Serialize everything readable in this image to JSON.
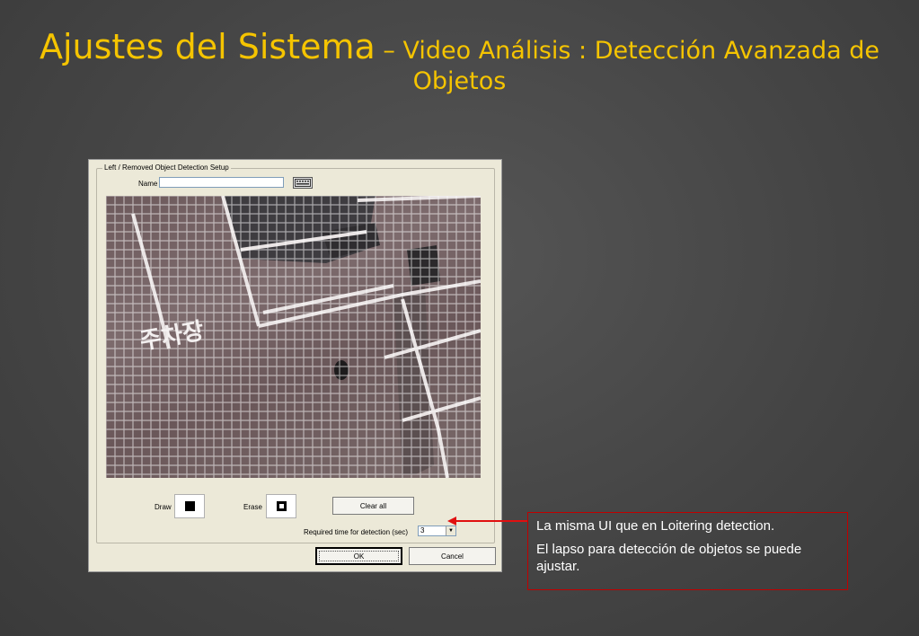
{
  "slide": {
    "title_main": "Ajustes del Sistema",
    "title_sub": " – Video Análisis : Detección Avanzada de",
    "title_sub2": "Objetos",
    "title_color": "#f5c400"
  },
  "dialog": {
    "group_label": "Left / Removed Object Detection Setup",
    "name_label": "Name",
    "name_value": "",
    "keyboard_icon": "keyboard-icon",
    "draw_label": "Draw",
    "erase_label": "Erase",
    "clear_all_label": "Clear all",
    "required_time_label": "Required time for detection (sec)",
    "required_time_value": "3",
    "ok_label": "OK",
    "cancel_label": "Cancel",
    "scene_text": "주차장"
  },
  "callout": {
    "line1": "La misma  UI que en  Loitering detection.",
    "line2": "El lapso para detección de objetos se puede ajustar.",
    "border_color": "#c00000"
  }
}
